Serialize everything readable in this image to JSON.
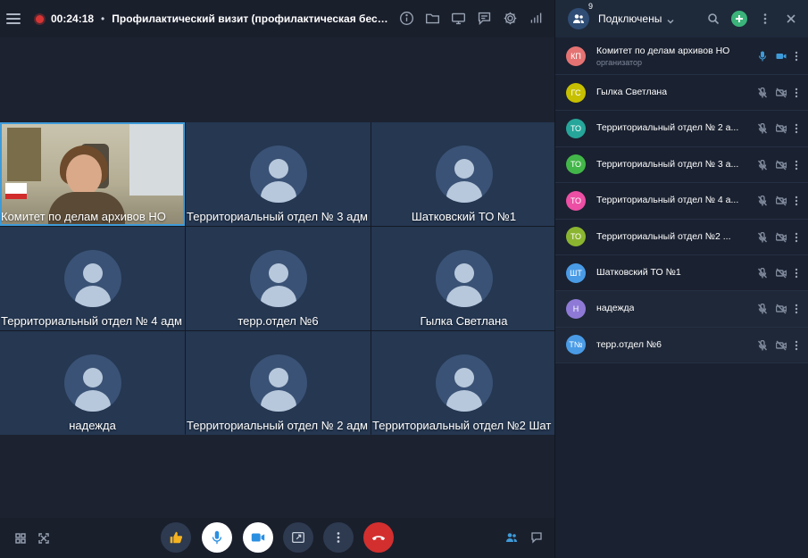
{
  "topbar": {
    "timer": "00:24:18",
    "separator": "•",
    "title": "Профилактический визит (профилактическая беседа)",
    "icons": [
      "info-icon",
      "folder-icon",
      "screen-share-icon",
      "chat-icon",
      "settings-icon",
      "signal-icon"
    ]
  },
  "tiles": [
    {
      "name": "Комитет по делам архивов НО",
      "video": true
    },
    {
      "name": "Территориальный отдел № 3 адм",
      "video": false
    },
    {
      "name": "Шатковский ТО №1",
      "video": false
    },
    {
      "name": "Территориальный отдел № 4 адм",
      "video": false
    },
    {
      "name": "терр.отдел №6",
      "video": false
    },
    {
      "name": "Гылка Светлана",
      "video": false
    },
    {
      "name": "надежда",
      "video": false
    },
    {
      "name": "Территориальный отдел № 2 адм",
      "video": false
    },
    {
      "name": "Территориальный отдел №2 Шат",
      "video": false
    }
  ],
  "panel": {
    "count": "9",
    "title": "Подключены",
    "participants": [
      {
        "initials": "КП",
        "color": "#e57373",
        "name": "Комитет по делам архивов НО",
        "sub": "организатор",
        "mic": true,
        "cam": true
      },
      {
        "initials": "ГС",
        "color": "#c6c000",
        "name": "Гылка Светлана",
        "mic": false,
        "cam": false
      },
      {
        "initials": "ТО",
        "color": "#26a69a",
        "name": "Территориальный отдел № 2 а...",
        "mic": false,
        "cam": false
      },
      {
        "initials": "ТО",
        "color": "#43b649",
        "name": "Территориальный отдел № 3 а...",
        "mic": false,
        "cam": false
      },
      {
        "initials": "ТО",
        "color": "#ec4fa4",
        "name": "Территориальный отдел № 4 а...",
        "mic": false,
        "cam": false
      },
      {
        "initials": "ТО",
        "color": "#8bb530",
        "name": "Территориальный отдел №2 ...",
        "mic": false,
        "cam": false
      },
      {
        "initials": "ШТ",
        "color": "#4a9be6",
        "name": "Шатковский ТО №1",
        "mic": false,
        "cam": false
      },
      {
        "initials": "Н",
        "color": "#8e7ad6",
        "name": "надежда",
        "mic": false,
        "cam": false
      },
      {
        "initials": "Т№",
        "color": "#4a9be6",
        "name": "терр.отдел №6",
        "mic": false,
        "cam": false
      }
    ]
  }
}
